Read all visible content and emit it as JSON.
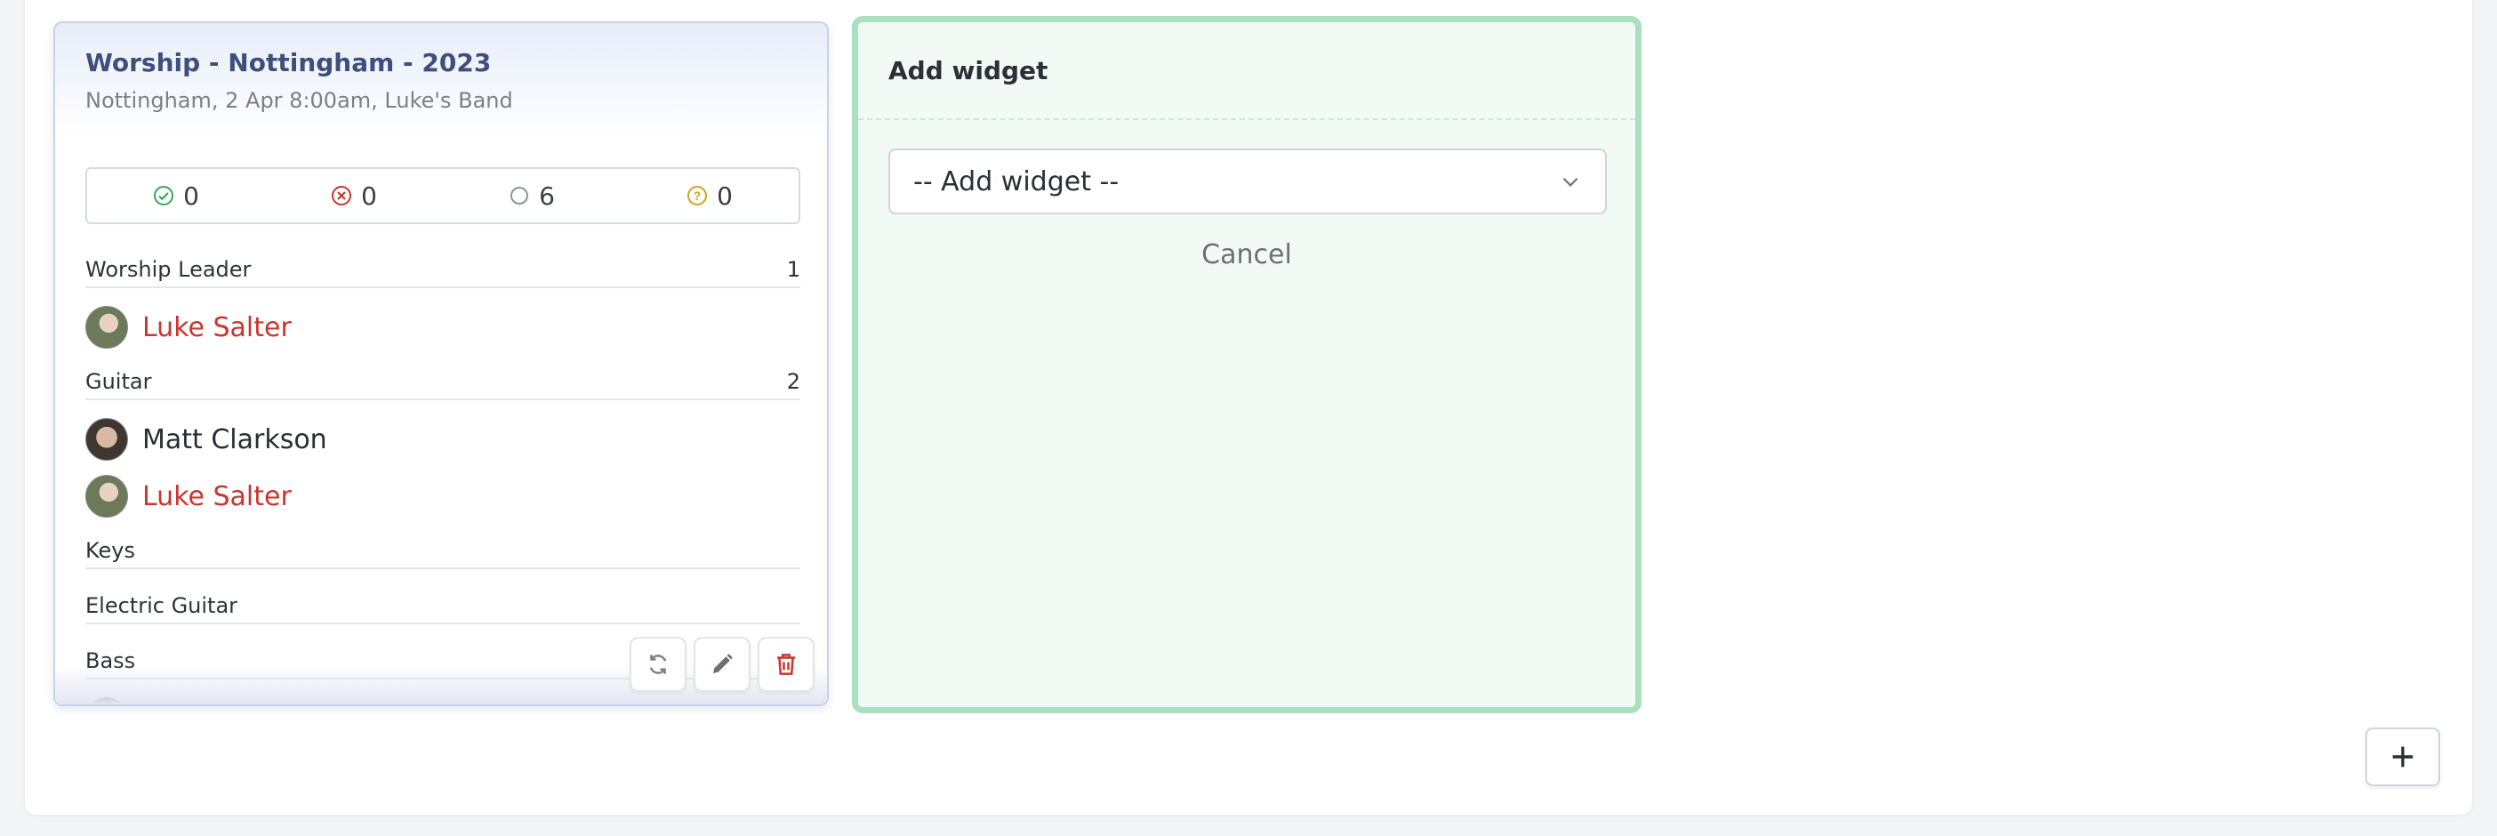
{
  "event": {
    "title": "Worship - Nottingham - 2023",
    "subtitle": "Nottingham, 2 Apr 8:00am, Luke's Band",
    "counts": {
      "accepted": "0",
      "declined": "0",
      "pending": "6",
      "unknown": "0"
    },
    "roles": [
      {
        "label": "Worship Leader",
        "count": "1"
      },
      {
        "label": "Guitar",
        "count": "2"
      },
      {
        "label": "Keys",
        "count": ""
      },
      {
        "label": "Electric Guitar",
        "count": ""
      },
      {
        "label": "Bass",
        "count": ""
      }
    ],
    "people": [
      {
        "name": "Luke Salter"
      },
      {
        "name": "Matt Clarkson"
      },
      {
        "name": "Luke Salter"
      }
    ]
  },
  "add_widget": {
    "title": "Add widget",
    "select_value": "-- Add widget --",
    "cancel_label": "Cancel"
  },
  "colors": {
    "accent_green": "#a9e0be",
    "declined_red": "#c9362f",
    "accepted_green": "#3aa55d",
    "unknown_yellow": "#d4a21c"
  },
  "icons": [
    "check-circle-icon",
    "x-circle-icon",
    "empty-circle-icon",
    "question-circle-icon",
    "refresh-icon",
    "pencil-icon",
    "trash-icon",
    "chevron-down-icon",
    "plus-icon"
  ]
}
